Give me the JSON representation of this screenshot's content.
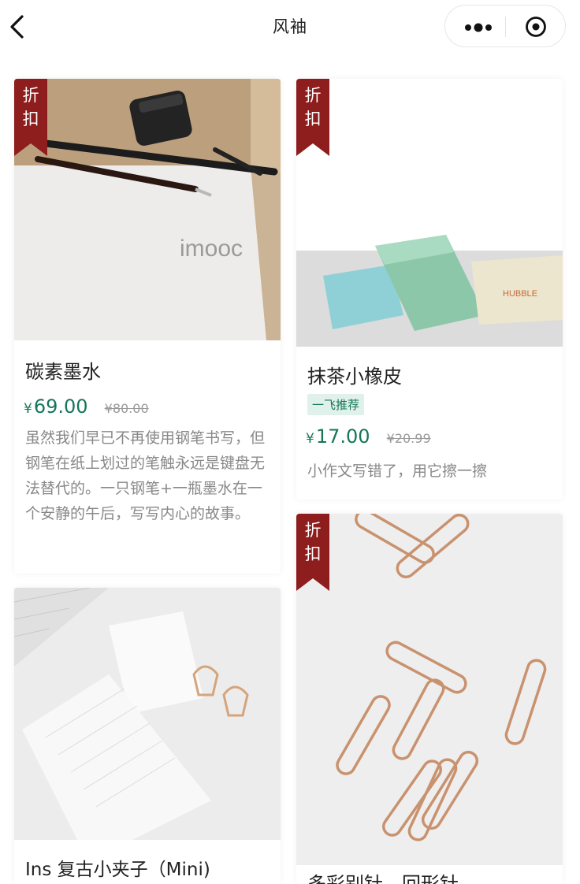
{
  "nav": {
    "title": "风袖"
  },
  "products": [
    {
      "badge": [
        "折",
        "扣"
      ],
      "title": "碳素墨水",
      "price_symbol": "¥",
      "price": "69.00",
      "old_price": "¥80.00",
      "description": "虽然我们早已不再使用钢笔书写，但钢笔在纸上划过的笔触永远是键盘无法替代的。一只钢笔+一瓶墨水在一个安静的午后，写写内心的故事。",
      "watermark": "imooc"
    },
    {
      "badge": [
        "折",
        "扣"
      ],
      "title": "抹茶小橡皮",
      "tag": "一飞推荐",
      "price_symbol": "¥",
      "price": "17.00",
      "old_price": "¥20.99",
      "description": "小作文写错了，用它擦一擦",
      "eraser_brand": "HUBBLE"
    },
    {
      "title": "Ins 复古小夹子（Mini)"
    },
    {
      "badge": [
        "折",
        "扣"
      ],
      "title": "多彩别针，回形针"
    }
  ],
  "colors": {
    "accent": "#157658",
    "badge": "#8e1d1d"
  }
}
